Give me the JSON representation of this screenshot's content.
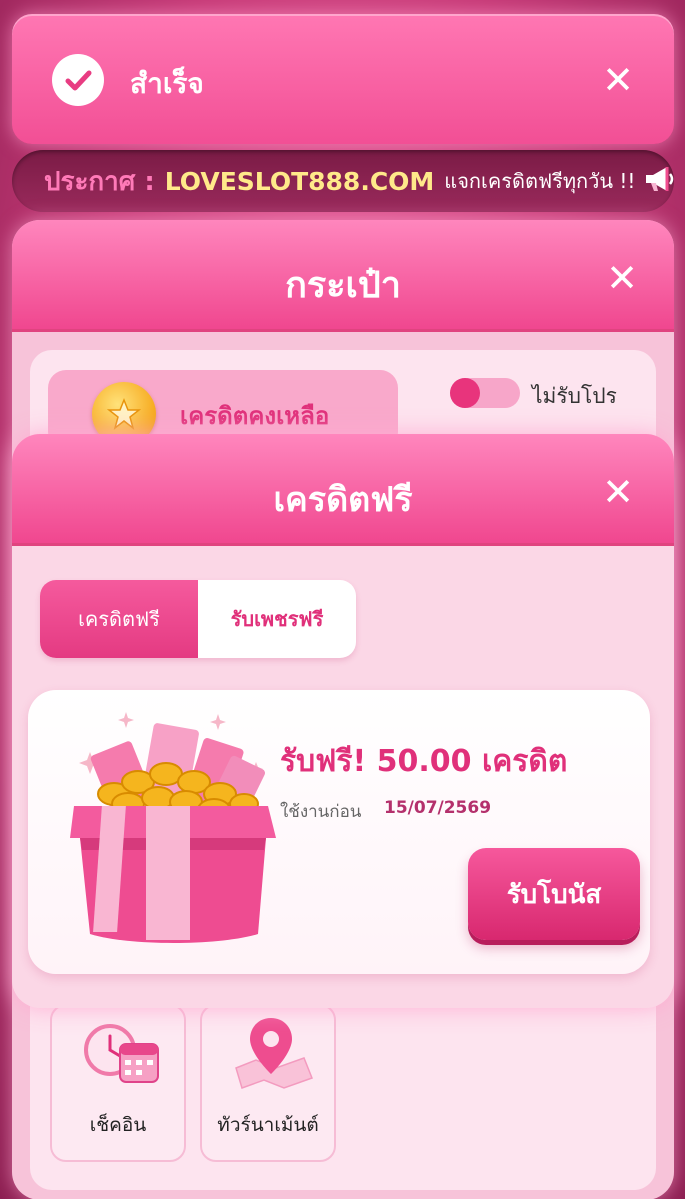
{
  "toast": {
    "message": "สำเร็จ",
    "check_icon": "check-circle-icon",
    "close_icon": "close-icon"
  },
  "announcement": {
    "label": "ประกาศ :",
    "site": "LOVESLOT888.COM",
    "message": "แจกเครดิตฟรีทุกวัน !!",
    "icon": "megaphone-icon"
  },
  "wallet": {
    "title": "กระเป๋า",
    "balance_label": "เครดิตคงเหลือ",
    "promo_toggle_label": "ไม่รับโปร",
    "promo_toggle_on": false,
    "tiles": [
      {
        "label": "เช็คอิน",
        "icon": "calendar-clock-icon"
      },
      {
        "label": "ทัวร์นาเม้นต์",
        "icon": "map-pin-icon"
      }
    ]
  },
  "free_credit": {
    "title": "เครดิตฟรี",
    "tabs": [
      {
        "label": "เครดิตฟรี",
        "active": true
      },
      {
        "label": "รับเพชรฟรี",
        "active": false
      }
    ],
    "bonus": {
      "amount_text": "รับฟรี! 50.00 เครดิต",
      "expire_label": "ใช้งานก่อน",
      "expire_date": "15/07/2569",
      "claim_label": "รับโบนัส"
    }
  },
  "colors": {
    "primary": "#f0478f",
    "accent_text": "#e0307a",
    "site_yellow": "#ffe98a",
    "announce_bg": "#7a1b45"
  }
}
